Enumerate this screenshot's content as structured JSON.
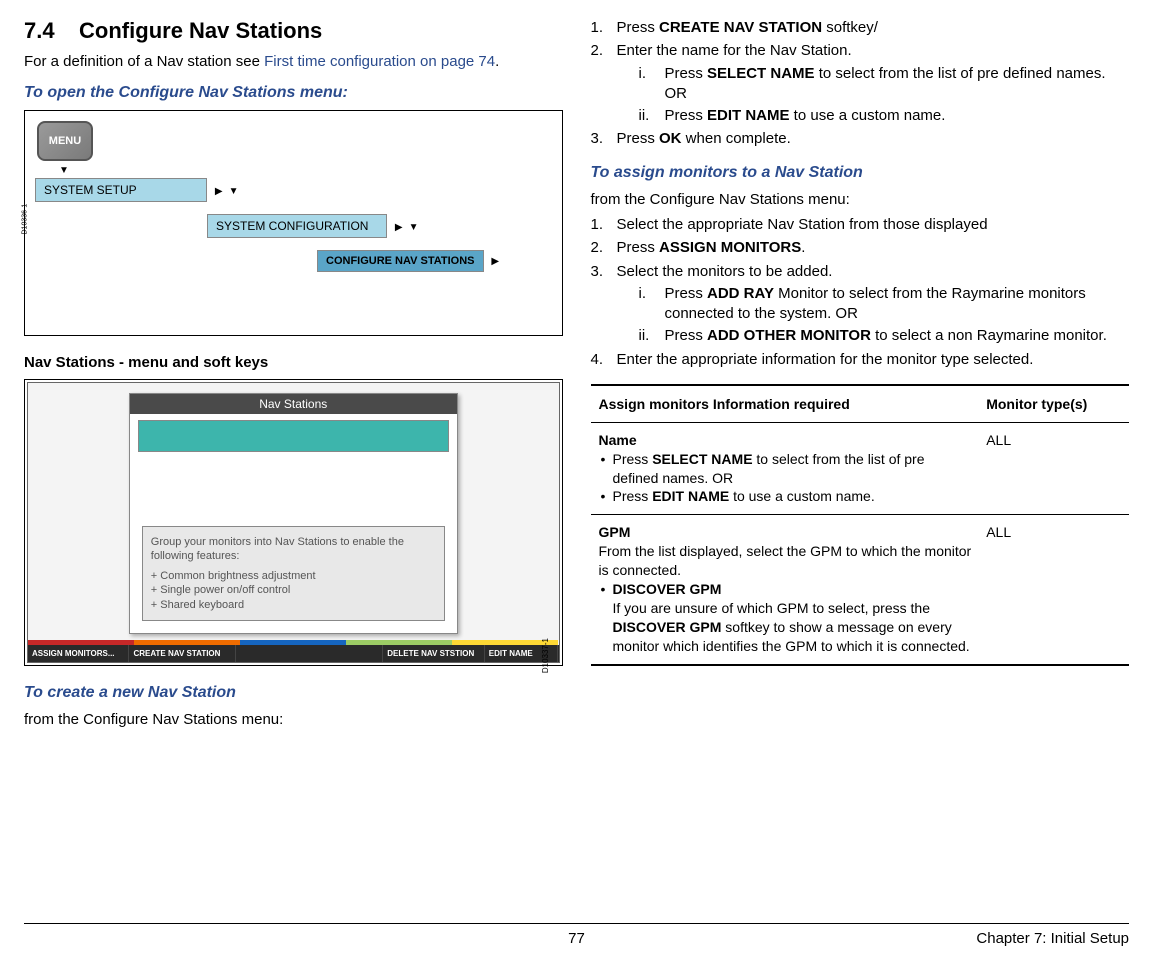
{
  "left": {
    "heading_num": "7.4",
    "heading_text": "Configure Nav Stations",
    "intro_pre": "For a definition of a Nav station see ",
    "intro_link": "First time configuration on page 74",
    "intro_post": ".",
    "sub1": "To open the Configure Nav Stations menu:",
    "flow": {
      "menu_label": "MENU",
      "step1": "SYSTEM SETUP",
      "step2": "SYSTEM CONFIGURATION",
      "step3": "CONFIGURE NAV STATIONS",
      "ref": "D10336-1"
    },
    "nav_heading": "Nav Stations - menu and soft keys",
    "screenshot": {
      "title": "Nav Stations",
      "info_line1": "Group your monitors into Nav Stations to enable the following features:",
      "info_b1": "+ Common brightness adjustment",
      "info_b2": "+ Single power on/off control",
      "info_b3": "+ Shared keyboard",
      "ref": "D10337-1",
      "softkeys": {
        "k1": "ASSIGN MONITORS...",
        "k2": "CREATE NAV STATION",
        "k3": "",
        "k4": "DELETE NAV STSTION",
        "k5": "EDIT NAME"
      }
    },
    "sub2": "To create a new Nav Station",
    "sub2_after": "from the Configure Nav Stations menu:"
  },
  "right": {
    "list1": {
      "i1_pre": "Press ",
      "i1_b": "CREATE NAV STATION",
      "i1_post": " softkey/",
      "i2": "Enter the name for the Nav Station.",
      "i2a_pre": "Press ",
      "i2a_b": "SELECT NAME",
      "i2a_post": " to select from the list of pre defined names. OR",
      "i2b_pre": "Press ",
      "i2b_b": "EDIT NAME",
      "i2b_post": " to use a custom name.",
      "i3_pre": "Press ",
      "i3_b": "OK",
      "i3_post": " when complete."
    },
    "sub1": "To assign monitors to a Nav Station",
    "sub1_after": "from the Configure Nav Stations menu:",
    "list2": {
      "i1": "Select the appropriate Nav Station from those displayed",
      "i2_pre": "Press ",
      "i2_b": "ASSIGN MONITORS",
      "i2_post": ".",
      "i3": "Select the monitors to be added.",
      "i3a_pre": "Press ",
      "i3a_b": "ADD RAY",
      "i3a_post": " Monitor to select from the Raymarine monitors connected to the system. OR",
      "i3b_pre": "Press ",
      "i3b_b": "ADD OTHER MONITOR",
      "i3b_post": " to select a non Raymarine monitor.",
      "i4": "Enter the appropriate information for the monitor type selected."
    },
    "table": {
      "h1": "Assign monitors Information required",
      "h2": "Monitor type(s)",
      "r1": {
        "title": "Name",
        "b1_pre": "Press ",
        "b1_b": "SELECT NAME",
        "b1_post": " to select from the list of pre defined names. OR",
        "b2_pre": "Press ",
        "b2_b": "EDIT NAME",
        "b2_post": " to use a custom name.",
        "c2": "ALL"
      },
      "r2": {
        "title": "GPM",
        "desc": "From the list displayed, select the GPM to which the monitor is connected.",
        "b1_b": "DISCOVER GPM",
        "b1_post_pre": "If you are unsure of which GPM to select, press the ",
        "b1_post_b": "DISCOVER GPM",
        "b1_post_post": " softkey to show a message on every monitor which identifies the GPM to which it is connected.",
        "c2": "ALL"
      }
    }
  },
  "footer": {
    "page": "77",
    "chapter": "Chapter 7: Initial Setup"
  }
}
